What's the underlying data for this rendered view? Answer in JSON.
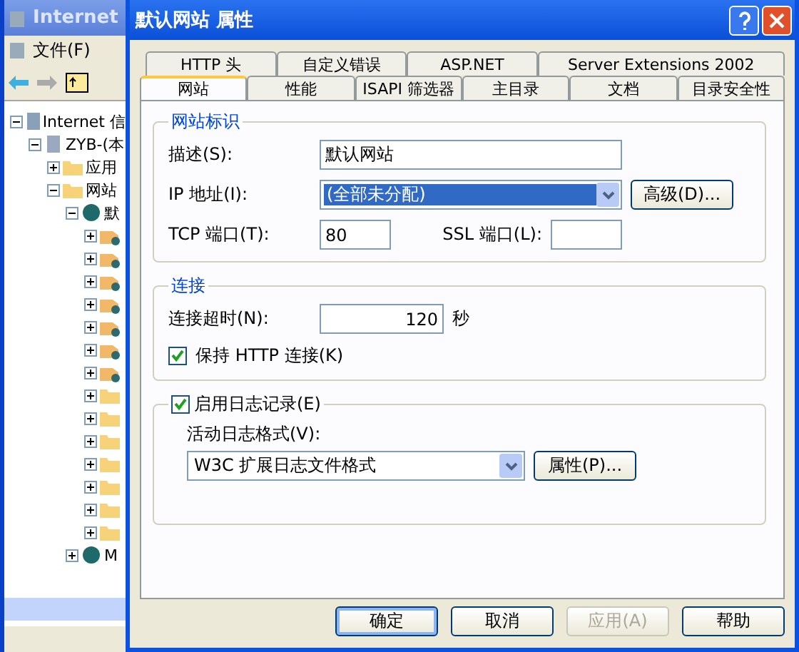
{
  "background_window": {
    "title": "Internet",
    "menu": [
      "文件(F)"
    ],
    "tree": [
      {
        "label": "Internet 信",
        "kind": "server-group",
        "expanded": true,
        "children": [
          {
            "label": "ZYB-(本",
            "kind": "computer",
            "expanded": true,
            "children": [
              {
                "label": "应用",
                "kind": "folder",
                "expanded": false
              },
              {
                "label": "网站",
                "kind": "folder",
                "expanded": true,
                "children": [
                  {
                    "label": "默",
                    "kind": "globe",
                    "expanded": true,
                    "children": [
                      {
                        "kind": "app",
                        "expanded": false
                      },
                      {
                        "kind": "app",
                        "expanded": false
                      },
                      {
                        "kind": "app",
                        "expanded": false
                      },
                      {
                        "kind": "app",
                        "expanded": false
                      },
                      {
                        "kind": "app",
                        "expanded": false
                      },
                      {
                        "kind": "app",
                        "expanded": false
                      },
                      {
                        "kind": "app",
                        "expanded": false
                      },
                      {
                        "kind": "folder",
                        "expanded": false
                      },
                      {
                        "kind": "folder",
                        "expanded": false
                      },
                      {
                        "kind": "folder",
                        "expanded": false
                      },
                      {
                        "kind": "folder",
                        "expanded": false
                      },
                      {
                        "kind": "folder",
                        "expanded": false
                      },
                      {
                        "kind": "folder",
                        "expanded": false
                      },
                      {
                        "kind": "folder",
                        "expanded": false
                      }
                    ]
                  },
                  {
                    "label": "M",
                    "kind": "globe",
                    "expanded": false
                  }
                ]
              }
            ]
          }
        ]
      }
    ]
  },
  "dialog": {
    "title": "默认网站 属性",
    "tab_rows": [
      [
        {
          "label": "HTTP 头",
          "selected": false
        },
        {
          "label": "自定义错误",
          "selected": false
        },
        {
          "label": "ASP.NET",
          "selected": false
        },
        {
          "label": "Server Extensions 2002",
          "selected": false
        }
      ],
      [
        {
          "label": "网站",
          "selected": true
        },
        {
          "label": "性能",
          "selected": false
        },
        {
          "label": "ISAPI 筛选器",
          "selected": false
        },
        {
          "label": "主目录",
          "selected": false
        },
        {
          "label": "文档",
          "selected": false
        },
        {
          "label": "目录安全性",
          "selected": false
        }
      ]
    ],
    "identification": {
      "title": "网站标识",
      "description_label": "描述(S):",
      "description": "默认网站",
      "ip_label": "IP 地址(I):",
      "ip": "(全部未分配)",
      "advanced_button": "高级(D)...",
      "tcp_label": "TCP 端口(T):",
      "tcp": "80",
      "ssl_label": "SSL 端口(L):"
    },
    "connection": {
      "title": "连接",
      "timeout_label": "连接超时(N):",
      "timeout": "120",
      "unit": "秒",
      "keep_alive": {
        "label": "保持 HTTP 连接(K)",
        "checked": true
      }
    },
    "logging": {
      "enable": {
        "label": "启用日志记录(E)",
        "checked": true
      },
      "format_label": "活动日志格式(V):",
      "format": "W3C 扩展日志文件格式",
      "properties_button": "属性(P)..."
    },
    "buttons": [
      {
        "label": "确定",
        "default": true,
        "disabled": false
      },
      {
        "label": "取消",
        "default": false,
        "disabled": false
      },
      {
        "label": "应用(A)",
        "default": false,
        "disabled": true
      },
      {
        "label": "帮助",
        "default": false,
        "disabled": false
      }
    ]
  }
}
